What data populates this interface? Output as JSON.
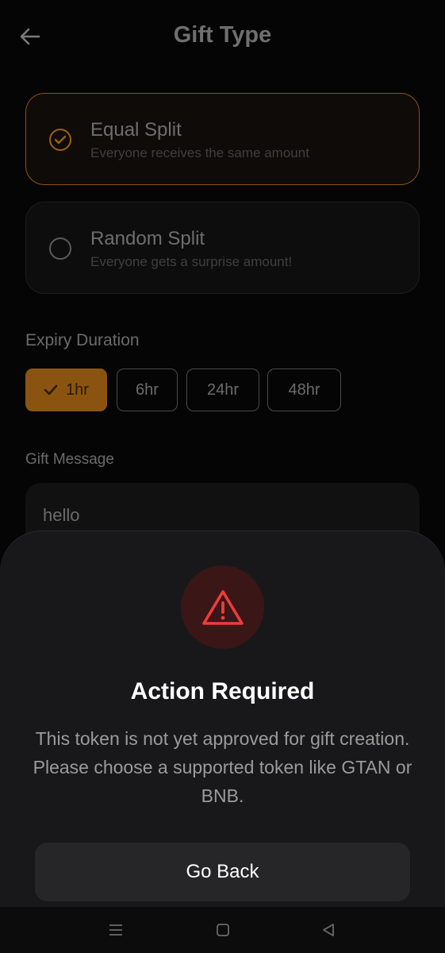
{
  "header": {
    "title": "Gift Type",
    "back_icon": "arrow-left-icon"
  },
  "gift_types": [
    {
      "title": "Equal Split",
      "subtitle": "Everyone receives the same amount",
      "selected": true
    },
    {
      "title": "Random Split",
      "subtitle": "Everyone gets a surprise amount!",
      "selected": false
    }
  ],
  "expiry": {
    "label": "Expiry Duration",
    "options": [
      "1hr",
      "6hr",
      "24hr",
      "48hr"
    ],
    "selected": "1hr"
  },
  "message": {
    "label": "Gift Message",
    "value": "hello"
  },
  "dialog": {
    "icon": "warning-triangle-icon",
    "title": "Action Required",
    "body": "This token is not yet approved for gift creation. Please choose a supported token like GTAN or BNB.",
    "button_label": "Go Back"
  },
  "colors": {
    "accent": "#8a5410",
    "warning": "#e53935",
    "sheet_bg": "#18181a"
  }
}
